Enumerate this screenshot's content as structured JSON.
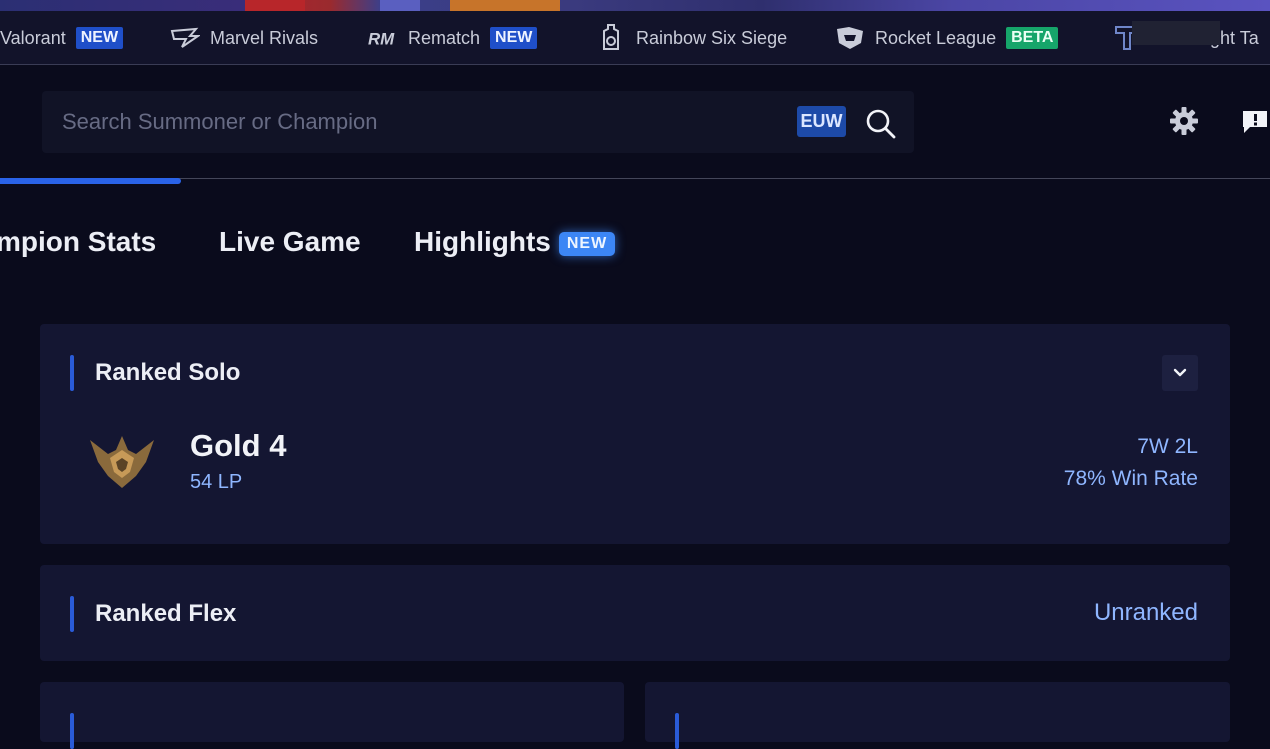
{
  "games": [
    {
      "label": "Valorant",
      "badge": "NEW",
      "icon": "valorant-icon"
    },
    {
      "label": "Marvel Rivals",
      "icon": "marvel-rivals-icon"
    },
    {
      "label": "Rematch",
      "badge": "NEW",
      "icon": "rematch-icon"
    },
    {
      "label": "Rainbow Six Siege",
      "icon": "rainbow-six-icon"
    },
    {
      "label": "Rocket League",
      "badge": "BETA",
      "icon": "rocket-league-icon"
    },
    {
      "label": "ght Ta",
      "icon": "teamfight-tactics-icon"
    }
  ],
  "search": {
    "placeholder": "Search Summoner or Champion",
    "region": "EUW"
  },
  "tabs": [
    {
      "label": "mpion Stats"
    },
    {
      "label": "Live Game"
    },
    {
      "label": "Highlights",
      "badge": "NEW"
    }
  ],
  "ranked_solo": {
    "title": "Ranked Solo",
    "tier": "Gold 4",
    "lp": "54 LP",
    "record": "7W 2L",
    "win_rate": "78% Win Rate"
  },
  "ranked_flex": {
    "title": "Ranked Flex",
    "status": "Unranked"
  },
  "colors": {
    "background": "#0a0b1c",
    "card": "#141632",
    "accent_blue": "#2a5bd8",
    "link_blue": "#8fb6ff",
    "badge_new": "#1f4fc9",
    "badge_beta": "#16a56a"
  }
}
